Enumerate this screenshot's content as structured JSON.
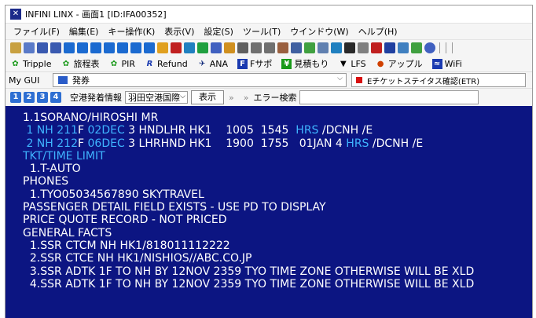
{
  "window": {
    "title": "INFINI LINX - 画面1 [ID:IFA00352]"
  },
  "menu": [
    "ファイル(F)",
    "編集(E)",
    "キー操作(K)",
    "表示(V)",
    "設定(S)",
    "ツール(T)",
    "ウインドウ(W)",
    "ヘルプ(H)"
  ],
  "quick": [
    {
      "label": "Tripple",
      "icon": "clover-icon",
      "color": "#1a9a1a"
    },
    {
      "label": "旅程表",
      "icon": "clover-icon",
      "color": "#1a9a1a"
    },
    {
      "label": "PIR",
      "icon": "clover-icon",
      "color": "#1a9a1a"
    },
    {
      "label": "Refund",
      "icon": "rm-icon",
      "color": "#1a3ab0"
    },
    {
      "label": "ANA",
      "icon": "plane-icon",
      "color": "#102a7a"
    },
    {
      "label": "Fサポ",
      "icon": "f-icon",
      "color": "#1a3ab0"
    },
    {
      "label": "見積もり",
      "icon": "yen-icon",
      "color": "#1a9a1a"
    },
    {
      "label": "LFS",
      "icon": "cart-icon",
      "color": "#000"
    },
    {
      "label": "アップル",
      "icon": "apple-icon",
      "color": "#d04000"
    },
    {
      "label": "WiFi",
      "icon": "wifi-icon",
      "color": "#1a3ab0"
    }
  ],
  "gui": {
    "label": "My GUI",
    "selected": "発券",
    "etr": "Eチケットステイタス確認(ETR)"
  },
  "row4": {
    "buttons": [
      "1",
      "2",
      "3",
      "4"
    ],
    "label1": "空港発着情報",
    "combo": "羽田空港国際",
    "show": "表示",
    "chev1": "»",
    "chev2": "»",
    "errlabel": "エラー検索"
  },
  "terminal": {
    "lines": [
      [
        {
          "t": "1.1SORANO/HIROSHI MR",
          "c": "w"
        }
      ],
      [
        {
          "t": " 1 NH 211",
          "c": "c"
        },
        {
          "t": "F ",
          "c": "w"
        },
        {
          "t": "02DEC",
          "c": "c"
        },
        {
          "t": " 3 HNDLHR HK1    1005  1545  ",
          "c": "w"
        },
        {
          "t": "HRS",
          "c": "c"
        },
        {
          "t": " /DCNH /E",
          "c": "w"
        }
      ],
      [
        {
          "t": " 2 NH 212",
          "c": "c"
        },
        {
          "t": "F ",
          "c": "w"
        },
        {
          "t": "06DEC",
          "c": "c"
        },
        {
          "t": " 3 LHRHND HK1    1900  1755   01JAN 4 ",
          "c": "w"
        },
        {
          "t": "HRS",
          "c": "c"
        },
        {
          "t": " /DCNH /E",
          "c": "w"
        }
      ],
      [
        {
          "t": "TKT/TIME LIMIT",
          "c": "c"
        }
      ],
      [
        {
          "t": "  1.T-AUTO",
          "c": "w"
        }
      ],
      [
        {
          "t": "PHONES",
          "c": "w"
        }
      ],
      [
        {
          "t": "  1.TYO05034567890 SKYTRAVEL",
          "c": "w"
        }
      ],
      [
        {
          "t": "PASSENGER DETAIL FIELD EXISTS - USE PD TO DISPLAY",
          "c": "w"
        }
      ],
      [
        {
          "t": "PRICE QUOTE RECORD - NOT PRICED",
          "c": "w"
        }
      ],
      [
        {
          "t": "GENERAL FACTS",
          "c": "w"
        }
      ],
      [
        {
          "t": "  1.SSR CTCM NH HK1/818011112222",
          "c": "w"
        }
      ],
      [
        {
          "t": "  2.SSR CTCE NH HK1/NISHIOS//ABC.CO.JP",
          "c": "w"
        }
      ],
      [
        {
          "t": "  3.SSR ADTK 1F TO NH BY 12NOV 2359 TYO TIME ZONE OTHERWISE WILL BE XLD",
          "c": "w"
        }
      ],
      [
        {
          "t": "  4.SSR ADTK 1F TO NH BY 12NOV 2359 TYO TIME ZONE OTHERWISE WILL BE XLD",
          "c": "w"
        }
      ]
    ]
  }
}
